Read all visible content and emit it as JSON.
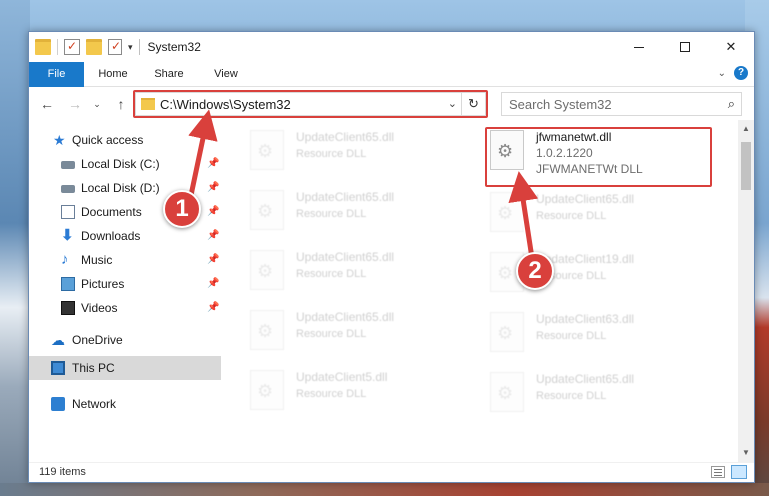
{
  "window": {
    "title": "System32",
    "qat_dropdown": "▾"
  },
  "ribbon": {
    "tabs": [
      "File",
      "Home",
      "Share",
      "View"
    ],
    "collapse_glyph": "⌄",
    "help_glyph": "?"
  },
  "navigation": {
    "back_glyph": "←",
    "forward_glyph": "→",
    "recent_glyph": "⌄",
    "up_glyph": "↑",
    "address": "C:\\Windows\\System32",
    "address_dropdown": "⌄",
    "refresh_glyph": "↻",
    "search_placeholder": "Search System32",
    "search_glyph": "⌕"
  },
  "sidebar": {
    "pin_glyph": "📌",
    "items": [
      {
        "label": "Quick access",
        "icon": "star-icon"
      },
      {
        "label": "Local Disk (C:)",
        "icon": "disk-icon",
        "pinned": true
      },
      {
        "label": "Local Disk (D:)",
        "icon": "disk-icon",
        "pinned": true
      },
      {
        "label": "Documents",
        "icon": "documents-icon",
        "pinned": true
      },
      {
        "label": "Downloads",
        "icon": "download-icon",
        "pinned": true
      },
      {
        "label": "Music",
        "icon": "music-icon",
        "pinned": true
      },
      {
        "label": "Pictures",
        "icon": "pictures-icon",
        "pinned": true
      },
      {
        "label": "Videos",
        "icon": "videos-icon",
        "pinned": true
      },
      {
        "label": "OneDrive",
        "icon": "onedrive-icon"
      },
      {
        "label": "This PC",
        "icon": "this-pc-icon",
        "selected": true
      },
      {
        "label": "Network",
        "icon": "network-icon"
      }
    ]
  },
  "files": {
    "highlighted": {
      "name": "jfwmanetwt.dll",
      "version": "1.0.2.1220",
      "description": "JFWMANETWt DLL"
    },
    "left_column": [
      {
        "name": "UpdateClient65.dll",
        "type": "Resource DLL"
      },
      {
        "name": "UpdateClient65.dll",
        "type": "Resource DLL"
      },
      {
        "name": "UpdateClient65.dll",
        "type": "Resource DLL"
      },
      {
        "name": "UpdateClient65.dll",
        "type": "Resource DLL"
      },
      {
        "name": "UpdateClient5.dll",
        "type": "Resource DLL"
      }
    ],
    "right_column": [
      {
        "name": "UpdateClient65.dll",
        "type": "Resource DLL"
      },
      {
        "name": "UpdateClient19.dll",
        "type": "Resource DLL"
      },
      {
        "name": "UpdateClient63.dll",
        "type": "Resource DLL"
      },
      {
        "name": "UpdateClient65.dll",
        "type": "Resource DLL"
      }
    ]
  },
  "status": {
    "item_count": "119 items"
  },
  "annotations": {
    "badge_1": "1",
    "badge_2": "2",
    "color": "#d9403c"
  },
  "colors": {
    "accent": "#1979ca",
    "selection": "#d9d9d9"
  }
}
